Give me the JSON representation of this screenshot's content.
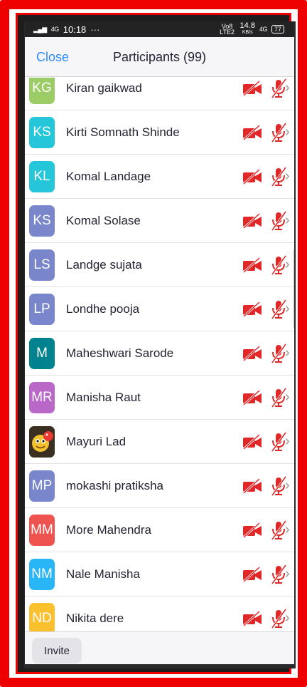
{
  "status_bar": {
    "signal_text": "4G",
    "time": "10:18",
    "dots": "···",
    "volte": "Vo8 LTE2",
    "speed_value": "14.8",
    "speed_unit": "KB/s",
    "net": "4G",
    "battery": "77"
  },
  "header": {
    "close_label": "Close",
    "title": "Participants (99)"
  },
  "participants": [
    {
      "initials": "KG",
      "name": "Kiran gaikwad",
      "color": "#9ccc65"
    },
    {
      "initials": "KS",
      "name": "Kirti Somnath Shinde",
      "color": "#26c6da"
    },
    {
      "initials": "KL",
      "name": "Komal Landage",
      "color": "#26c6da"
    },
    {
      "initials": "KS",
      "name": "Komal Solase",
      "color": "#7986cb"
    },
    {
      "initials": "LS",
      "name": "Landge sujata",
      "color": "#7986cb"
    },
    {
      "initials": "LP",
      "name": "Londhe pooja",
      "color": "#7986cb"
    },
    {
      "initials": "M",
      "name": "Maheshwari Sarode",
      "color": "#00838f"
    },
    {
      "initials": "MR",
      "name": "Manisha Raut",
      "color": "#ba68c8"
    },
    {
      "initials": "",
      "name": "Mayuri Lad",
      "color": "#4a3a2a",
      "photo": true
    },
    {
      "initials": "MP",
      "name": "mokashi pratiksha",
      "color": "#7986cb"
    },
    {
      "initials": "MM",
      "name": "More Mahendra",
      "color": "#ef5350"
    },
    {
      "initials": "NM",
      "name": "Nale Manisha",
      "color": "#29b6f6"
    },
    {
      "initials": "ND",
      "name": "Nikita dere",
      "color": "#fbc02d"
    }
  ],
  "footer": {
    "invite_label": "Invite"
  },
  "colors": {
    "accent": "#2d8cff",
    "muted_red": "#e02828"
  }
}
